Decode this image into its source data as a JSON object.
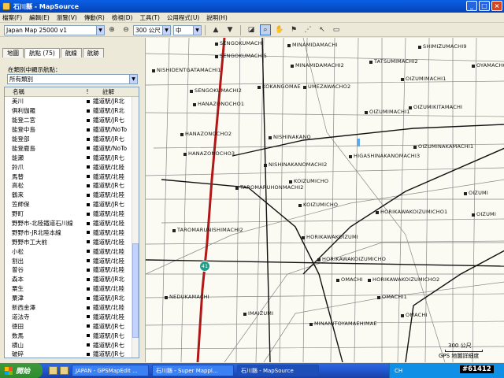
{
  "window": {
    "title": "石川縣 - MapSource"
  },
  "menu": [
    "檔案(F)",
    "編輯(E)",
    "瀏覽(V)",
    "傳動(R)",
    "檢視(D)",
    "工具(T)",
    "公用程式(U)",
    "說明(H)"
  ],
  "toolbar": {
    "product": "Japan Map 25000 v1",
    "scale": "300 公尺",
    "detail": "中"
  },
  "tabs": [
    "地圖",
    "航點 (75)",
    "航線",
    "航跡"
  ],
  "filter": {
    "label": "在類別中顯示航點：",
    "value": "所有類別"
  },
  "list": {
    "headers": [
      "名稱",
      "!",
      "註解"
    ],
    "rows": [
      [
        "美川",
        "鐵道駅/JR北"
      ],
      [
        "俱利伽羅",
        "鐵道駅/JR北"
      ],
      [
        "能登二宮",
        "鐵道駅/JR七"
      ],
      [
        "能登中島",
        "鐵道駅/NoTo"
      ],
      [
        "能登部",
        "鐵道駅/JR七"
      ],
      [
        "能登鹿島",
        "鐵道駅/NoTo"
      ],
      [
        "能瀬",
        "鐵道駅/JR七"
      ],
      [
        "鈴爪",
        "鐵道駅/北陸"
      ],
      [
        "馬替",
        "鐵道駅/北陸"
      ],
      [
        "高松",
        "鐵道駅/JR七"
      ],
      [
        "鶴来",
        "鐵道駅/北陸"
      ],
      [
        "笠師保",
        "鐵道駅/JR七"
      ],
      [
        "野町",
        "鐵道駅/北陸"
      ],
      [
        "野野市-北陸鐵道石川線",
        "鐵道駅/北陸"
      ],
      [
        "野野市-JR北陸本線",
        "鐵道駅/北陸"
      ],
      [
        "野野市工大前",
        "鐵道駅/北陸"
      ],
      [
        "小松",
        "鐵道駅/北陸"
      ],
      [
        "割出",
        "鐵道駅/北陸"
      ],
      [
        "曽谷",
        "鐵道駅/北陸"
      ],
      [
        "森本",
        "鐵道駅/JR北"
      ],
      [
        "粟生",
        "鐵道駅/北陸"
      ],
      [
        "粟津",
        "鐵道駅/JR北"
      ],
      [
        "新西金澤",
        "鐵道駅/北陸"
      ],
      [
        "道法寺",
        "鐵道駅/北陸"
      ],
      [
        "徳田",
        "鐵道駅/JR七"
      ],
      [
        "数馬",
        "鐵道駅/JR七"
      ],
      [
        "横山",
        "鐵道駅/JR七"
      ],
      [
        "破碎",
        "鐵道駅/JR七"
      ],
      [
        "額住宅前",
        "鐵道駅/北陸"
      ],
      [
        "寶達",
        "鐵道駅/JR七"
      ],
      [
        "鶴来",
        "鐵道駅/北陸"
      ]
    ]
  },
  "map": {
    "route_badge": "41",
    "scale_text": "300 公尺",
    "gps_text": "GPS 地圖詳細度",
    "labels": [
      "SENGOKUMACHI",
      "SENGOKUMACHI5",
      "NISHIDENTGATAMACHI1",
      "SENGOKUMACHI2",
      "HANAZONOCHO1",
      "HANAZONOCHO2",
      "HANAZONOCHO3",
      "MINAMIDAMACHI",
      "MINAMIDAMACHI2",
      "KOKANGOMAE",
      "UMEZAWACHO2",
      "TATSUMIMACHI2",
      "SHIMIZUMACHI9",
      "OYAMACHO",
      "OIZUMIMACHI1",
      "OIZUMIKITAMACHI",
      "OIZUMIMACHI1",
      "NISHINAKANO",
      "HIGASHINAKANOMACHI3",
      "OIZUMINAKAMACHI1",
      "NISHINAKANOMACHI2",
      "KOIZUMICHO",
      "TAROMARUHONMACHI2",
      "KOIZUMICHO",
      "OIZUMI",
      "HORIKAWAKOIZUMICHO1",
      "OIZUMI",
      "TAROMARUNISHIMACHI2",
      "HORIKAWAKOIZUMI",
      "HORIKAWAKOIZUMICHO",
      "OMACHI",
      "HORIKAWAKOIZUMICHO2",
      "OMACHI1",
      "NEDUKAMACHI",
      "OMACHI",
      "IMAIZUMI",
      "MINAMITOYAMAEHIMAE"
    ]
  },
  "taskbar": {
    "start": "開始",
    "items": [
      "JAPAN - GPSMapEdit ...",
      "石川縣 - Super Mappl...",
      "石川縣 - MapSource"
    ],
    "tray_text": "CH"
  },
  "watermark": "#61412"
}
